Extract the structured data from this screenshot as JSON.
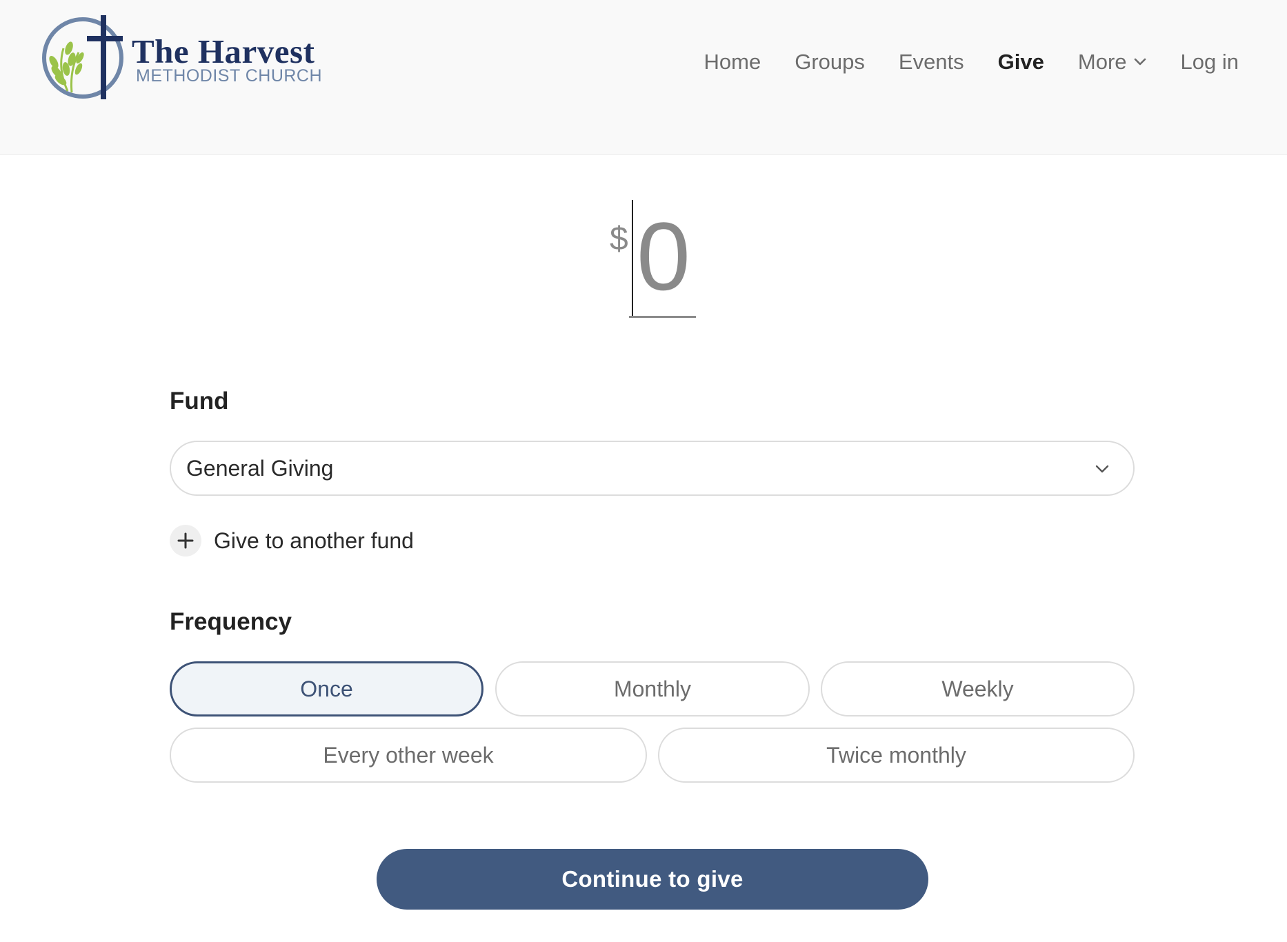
{
  "brand": {
    "title": "The Harvest",
    "subtitle": "METHODIST CHURCH",
    "colors": {
      "navy": "#1f3160",
      "slate": "#6f86a8",
      "wheat": "#9bc34a"
    }
  },
  "nav": {
    "items": [
      {
        "label": "Home",
        "active": false
      },
      {
        "label": "Groups",
        "active": false
      },
      {
        "label": "Events",
        "active": false
      },
      {
        "label": "Give",
        "active": true
      },
      {
        "label": "More",
        "active": false,
        "icon": "chevron-down-icon"
      },
      {
        "label": "Log in",
        "active": false
      }
    ]
  },
  "amount": {
    "currency_symbol": "$",
    "value": "0"
  },
  "fund": {
    "label": "Fund",
    "selected": "General Giving",
    "add_label": "Give to another fund"
  },
  "frequency": {
    "label": "Frequency",
    "options": [
      "Once",
      "Monthly",
      "Weekly",
      "Every other week",
      "Twice monthly"
    ],
    "selected": "Once"
  },
  "cta": {
    "label": "Continue to give",
    "color": "#415a80"
  }
}
